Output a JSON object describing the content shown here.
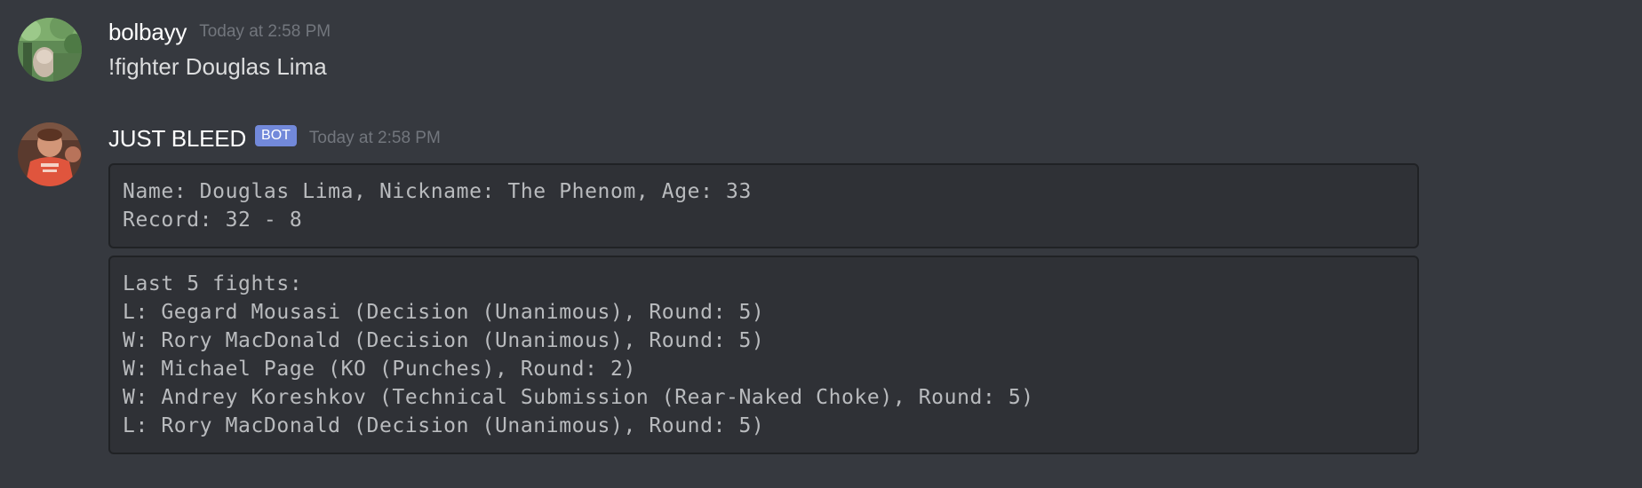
{
  "messages": [
    {
      "username": "bolbayy",
      "timestamp": "Today at 2:58 PM",
      "text": "!fighter Douglas Lima"
    },
    {
      "username": "JUST BLEED",
      "bot_tag": "BOT",
      "timestamp": "Today at 2:58 PM",
      "code_blocks": [
        {
          "lines": [
            "Name: Douglas Lima, Nickname: The Phenom, Age: 33",
            "Record: 32 - 8"
          ]
        },
        {
          "lines": [
            "Last 5 fights:",
            "L: Gegard Mousasi (Decision (Unanimous), Round: 5)",
            "W: Rory MacDonald (Decision (Unanimous), Round: 5)",
            "W: Michael Page (KO (Punches), Round: 2)",
            "W: Andrey Koreshkov (Technical Submission (Rear-Naked Choke), Round: 5)",
            "L: Rory MacDonald (Decision (Unanimous), Round: 5)"
          ]
        }
      ]
    }
  ],
  "colors": {
    "background": "#36393f",
    "username": "#ffffff",
    "timestamp": "#72767d",
    "message_text": "#dcddde",
    "bot_tag": "#7289da",
    "codeblock_bg": "#2f3136",
    "codeblock_text": "#b9bbbe"
  },
  "icons": {
    "user_avatar": "user-avatar-nature-photo",
    "bot_avatar": "bot-avatar-red-shirt-photo"
  }
}
